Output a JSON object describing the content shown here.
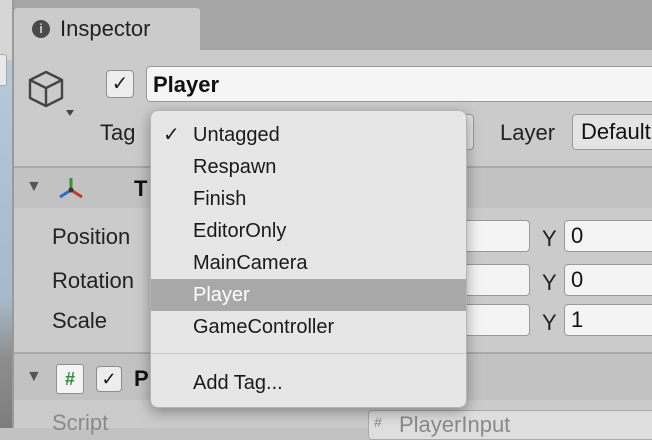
{
  "tab": {
    "title": "Inspector",
    "icon": "info-icon"
  },
  "header": {
    "object_icon": "cube-icon",
    "active": true,
    "name": "Player",
    "tag_label": "Tag",
    "layer_label": "Layer",
    "layer_value": "Default"
  },
  "transform": {
    "icon": "transform-icon",
    "title": "T",
    "rows": [
      {
        "label": "Position",
        "y_axis": "Y",
        "y_value": "0"
      },
      {
        "label": "Rotation",
        "y_axis": "Y",
        "y_value": "0"
      },
      {
        "label": "Scale",
        "y_axis": "Y",
        "y_value": "1"
      }
    ]
  },
  "script_component": {
    "icon": "script-icon",
    "icon_glyph": "#",
    "enabled": true,
    "title": "P",
    "script_label": "Script",
    "script_value": "PlayerInput"
  },
  "tag_menu": {
    "items": [
      {
        "label": "Untagged",
        "checked": true
      },
      {
        "label": "Respawn"
      },
      {
        "label": "Finish"
      },
      {
        "label": "EditorOnly"
      },
      {
        "label": "MainCamera"
      },
      {
        "label": "Player",
        "highlighted": true
      },
      {
        "label": "GameController"
      }
    ],
    "add_label": "Add Tag...",
    "check_glyph": "✓"
  },
  "colors": {
    "highlight": "#a8a8a8",
    "panel": "#cbcbcb",
    "tabbar": "#a5a5a5"
  }
}
